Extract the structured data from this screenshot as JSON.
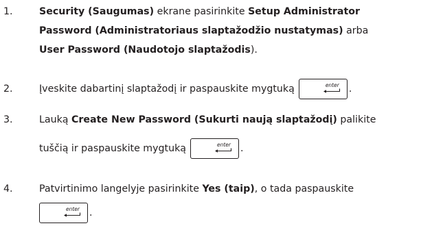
{
  "steps": [
    {
      "number": "1.",
      "lines": [
        [
          {
            "b": true,
            "t": "Security (Saugumas)"
          },
          {
            "b": false,
            "t": " ekrane pasirinkite "
          },
          {
            "b": true,
            "t": "Setup Administrator"
          }
        ],
        [
          {
            "b": true,
            "t": "Password (Administratoriaus slaptažodžio nustatymas)"
          },
          {
            "b": false,
            "t": " arba"
          }
        ],
        [
          {
            "b": true,
            "t": "User Password (Naudotojo slaptažodis"
          },
          {
            "b": false,
            "t": ")."
          }
        ]
      ]
    },
    {
      "number": "2.",
      "text": "Įveskite dabartinį slaptažodį ir paspauskite mygtuką",
      "end": "."
    },
    {
      "number": "3.",
      "line1_a": "Lauką ",
      "line1_b": "Create New Password (Sukurti naują slaptažodį)",
      "line1_c": " palikite",
      "line2": "tuščią ir paspauskite mygtuką",
      "end": "."
    },
    {
      "number": "4.",
      "line1_a": "Patvirtinimo langelyje pasirinkite ",
      "line1_b": "Yes (taip)",
      "line1_c": ", o tada paspauskite",
      "end": "."
    }
  ],
  "key_label": "enter",
  "key_icon": "return-arrow-icon"
}
